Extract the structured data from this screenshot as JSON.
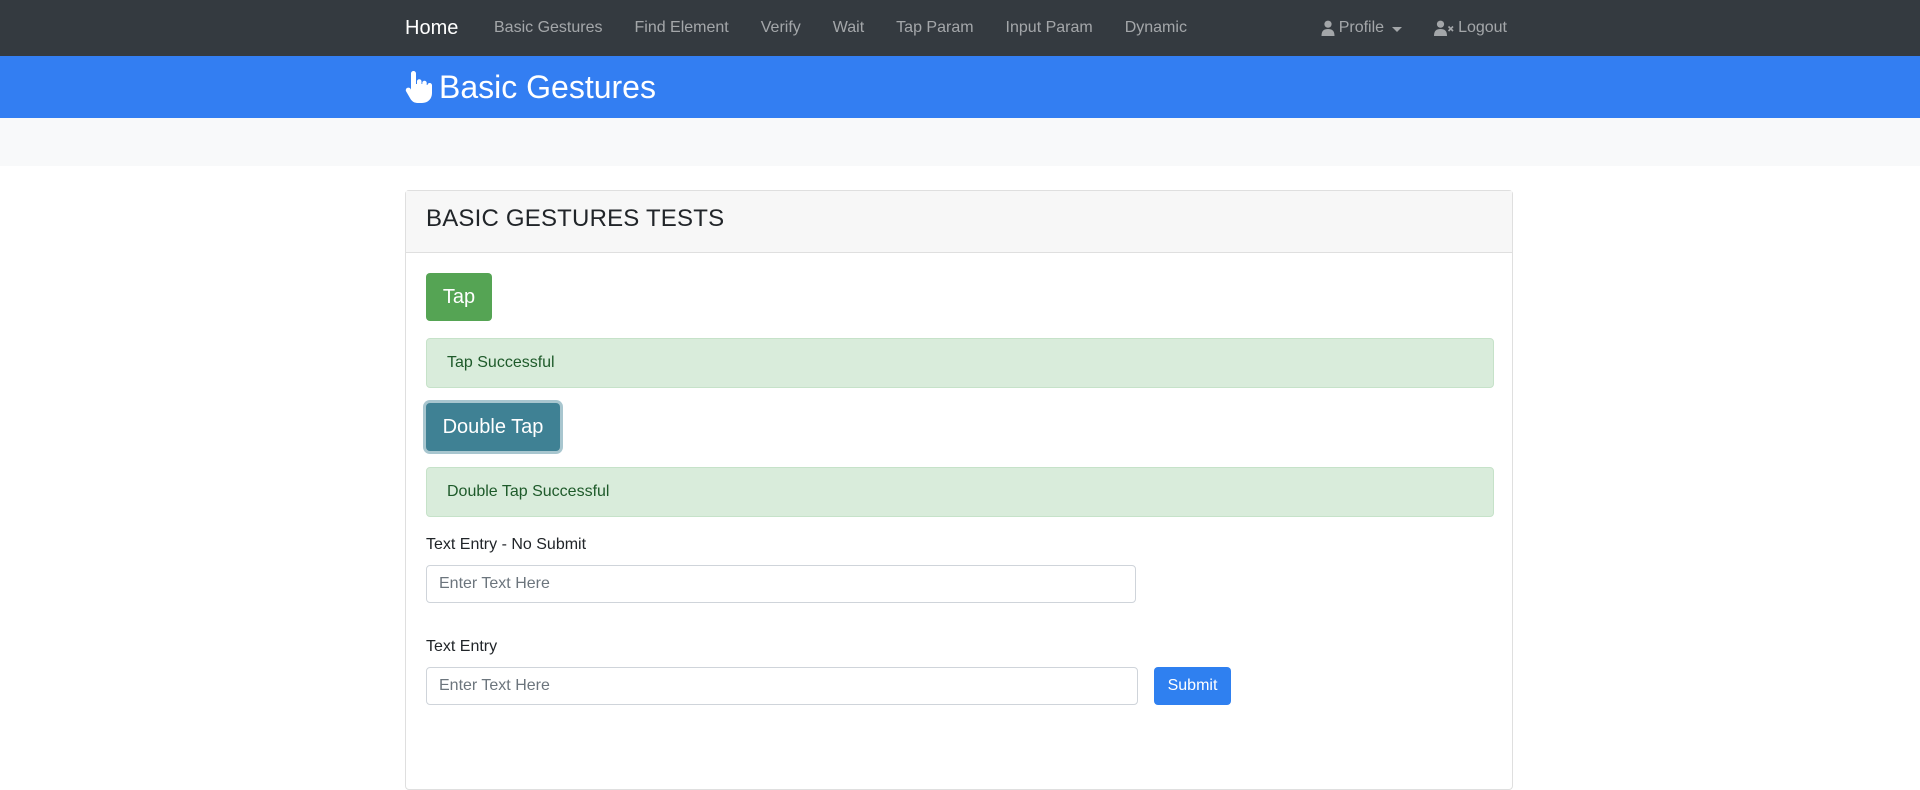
{
  "navbar": {
    "brand": "Home",
    "links": [
      "Basic Gestures",
      "Find Element",
      "Verify",
      "Wait",
      "Tap Param",
      "Input Param",
      "Dynamic"
    ],
    "profile_label": "Profile",
    "logout_label": "Logout"
  },
  "header": {
    "title": "Basic Gestures",
    "icon": "pointing-hand-icon"
  },
  "card": {
    "title": "BASIC GESTURES TESTS",
    "tap_button": "Tap",
    "tap_result": "Tap Successful",
    "double_tap_button": "Double Tap",
    "double_tap_result": "Double Tap Successful",
    "text_entry_no_submit": {
      "label": "Text Entry - No Submit",
      "placeholder": "Enter Text Here",
      "value": ""
    },
    "text_entry": {
      "label": "Text Entry",
      "placeholder": "Enter Text Here",
      "value": "",
      "submit_label": "Submit"
    }
  },
  "colors": {
    "navbar": "#343a40",
    "header": "#337ef2",
    "tap_button": "#55a454",
    "double_tap_button": "#3f8194",
    "alert_success": "#d9ecdb",
    "submit": "#2f80f0"
  }
}
